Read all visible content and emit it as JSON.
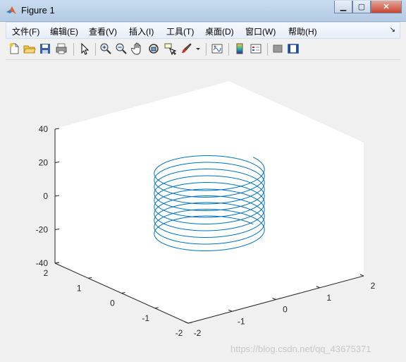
{
  "window": {
    "title": "Figure 1"
  },
  "menu": {
    "items": [
      "文件(F)",
      "编辑(E)",
      "查看(V)",
      "插入(I)",
      "工具(T)",
      "桌面(D)",
      "窗口(W)",
      "帮助(H)"
    ]
  },
  "toolbar": {
    "icons": [
      "new-figure-icon",
      "open-file-icon",
      "save-icon",
      "print-icon",
      "pointer-icon",
      "zoom-in-icon",
      "zoom-out-icon",
      "pan-icon",
      "rotate-3d-icon",
      "data-cursor-icon",
      "brush-icon",
      "link-plot-icon",
      "colorbar-icon",
      "legend-icon",
      "hide-plot-tools-icon",
      "show-plot-tools-icon"
    ]
  },
  "chart_data": {
    "type": "line",
    "plot_kind": "3d",
    "series": [
      {
        "curve": "helix",
        "radius": 1,
        "turns": 10,
        "z_range": [
          -20,
          20
        ],
        "color": "#0072bd"
      }
    ],
    "xlim": [
      -2,
      2
    ],
    "ylim": [
      -2,
      2
    ],
    "zlim": [
      -40,
      40
    ],
    "x_ticks": [
      "-2",
      "-1",
      "0",
      "1",
      "2"
    ],
    "y_ticks": [
      "-2",
      "-1",
      "0",
      "1",
      "2"
    ],
    "z_ticks": [
      "-40",
      "-20",
      "0",
      "20",
      "40"
    ],
    "grid": false
  },
  "watermark": "https://blog.csdn.net/qq_43675371"
}
